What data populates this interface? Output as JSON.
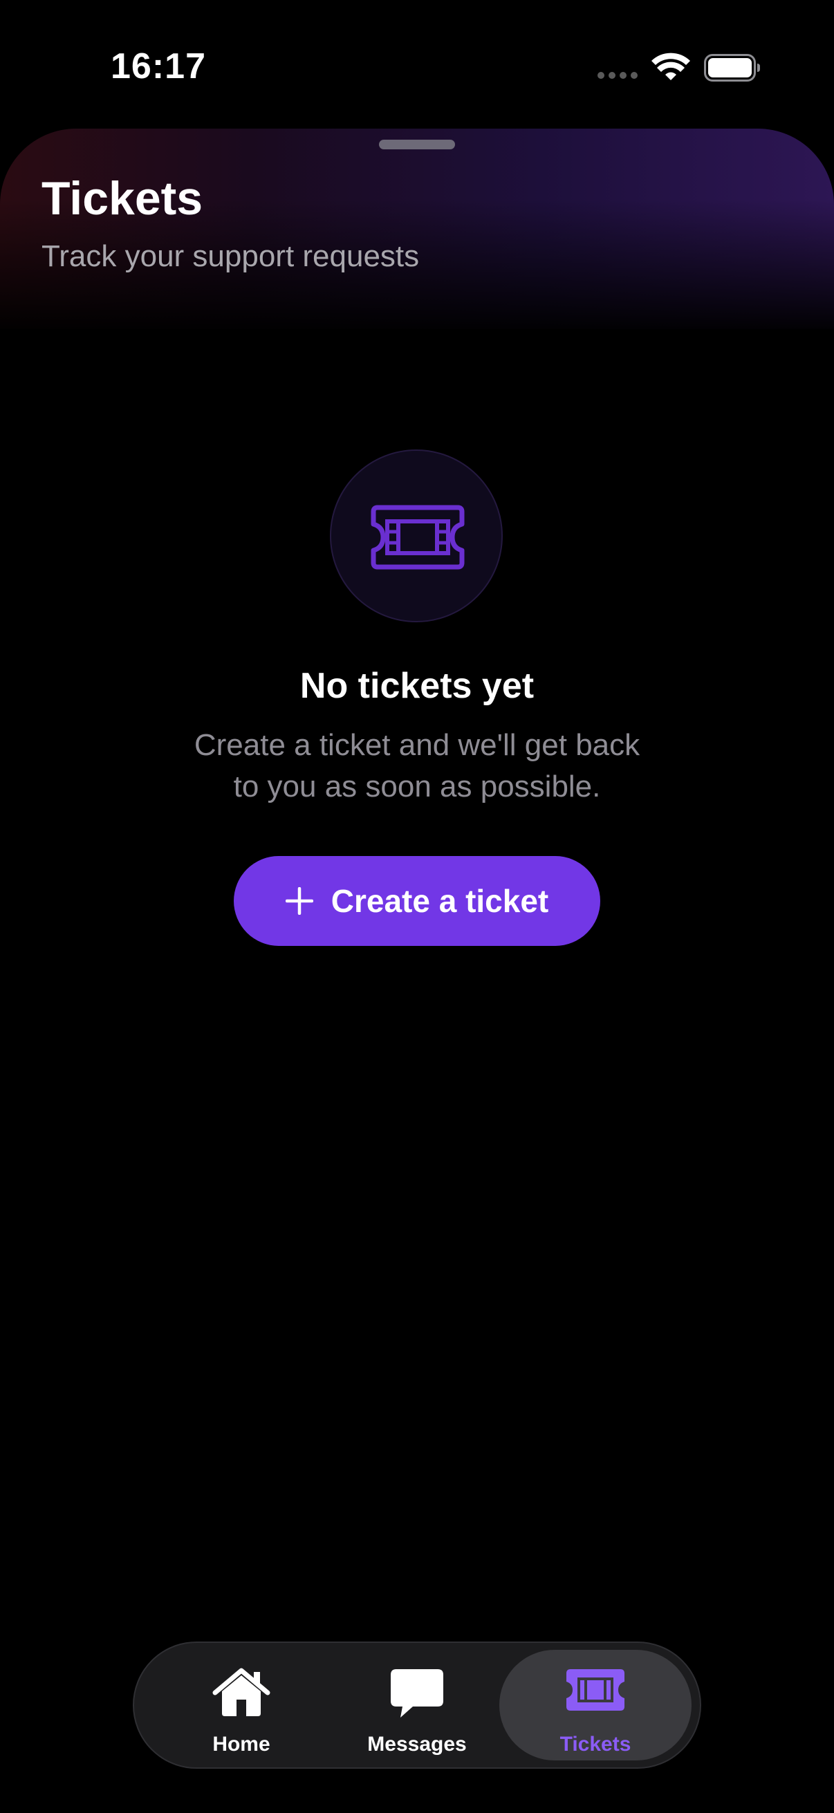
{
  "status_bar": {
    "time": "16:17"
  },
  "header": {
    "title": "Tickets",
    "subtitle": "Track your support requests"
  },
  "empty_state": {
    "icon": "ticket-icon",
    "title": "No tickets yet",
    "description_line1": "Create a ticket and we'll get back",
    "description_line2": "to you as soon as possible."
  },
  "create_button": {
    "icon": "plus-icon",
    "label": "Create a ticket"
  },
  "tab_bar": {
    "tabs": [
      {
        "label": "Home",
        "icon": "home-icon",
        "selected": false
      },
      {
        "label": "Messages",
        "icon": "chat-bubble-icon",
        "selected": false
      },
      {
        "label": "Tickets",
        "icon": "ticket-icon",
        "selected": true
      }
    ]
  },
  "colors": {
    "accent": "#7237e6",
    "accent_text": "#8b5cf6",
    "background": "#000000"
  }
}
